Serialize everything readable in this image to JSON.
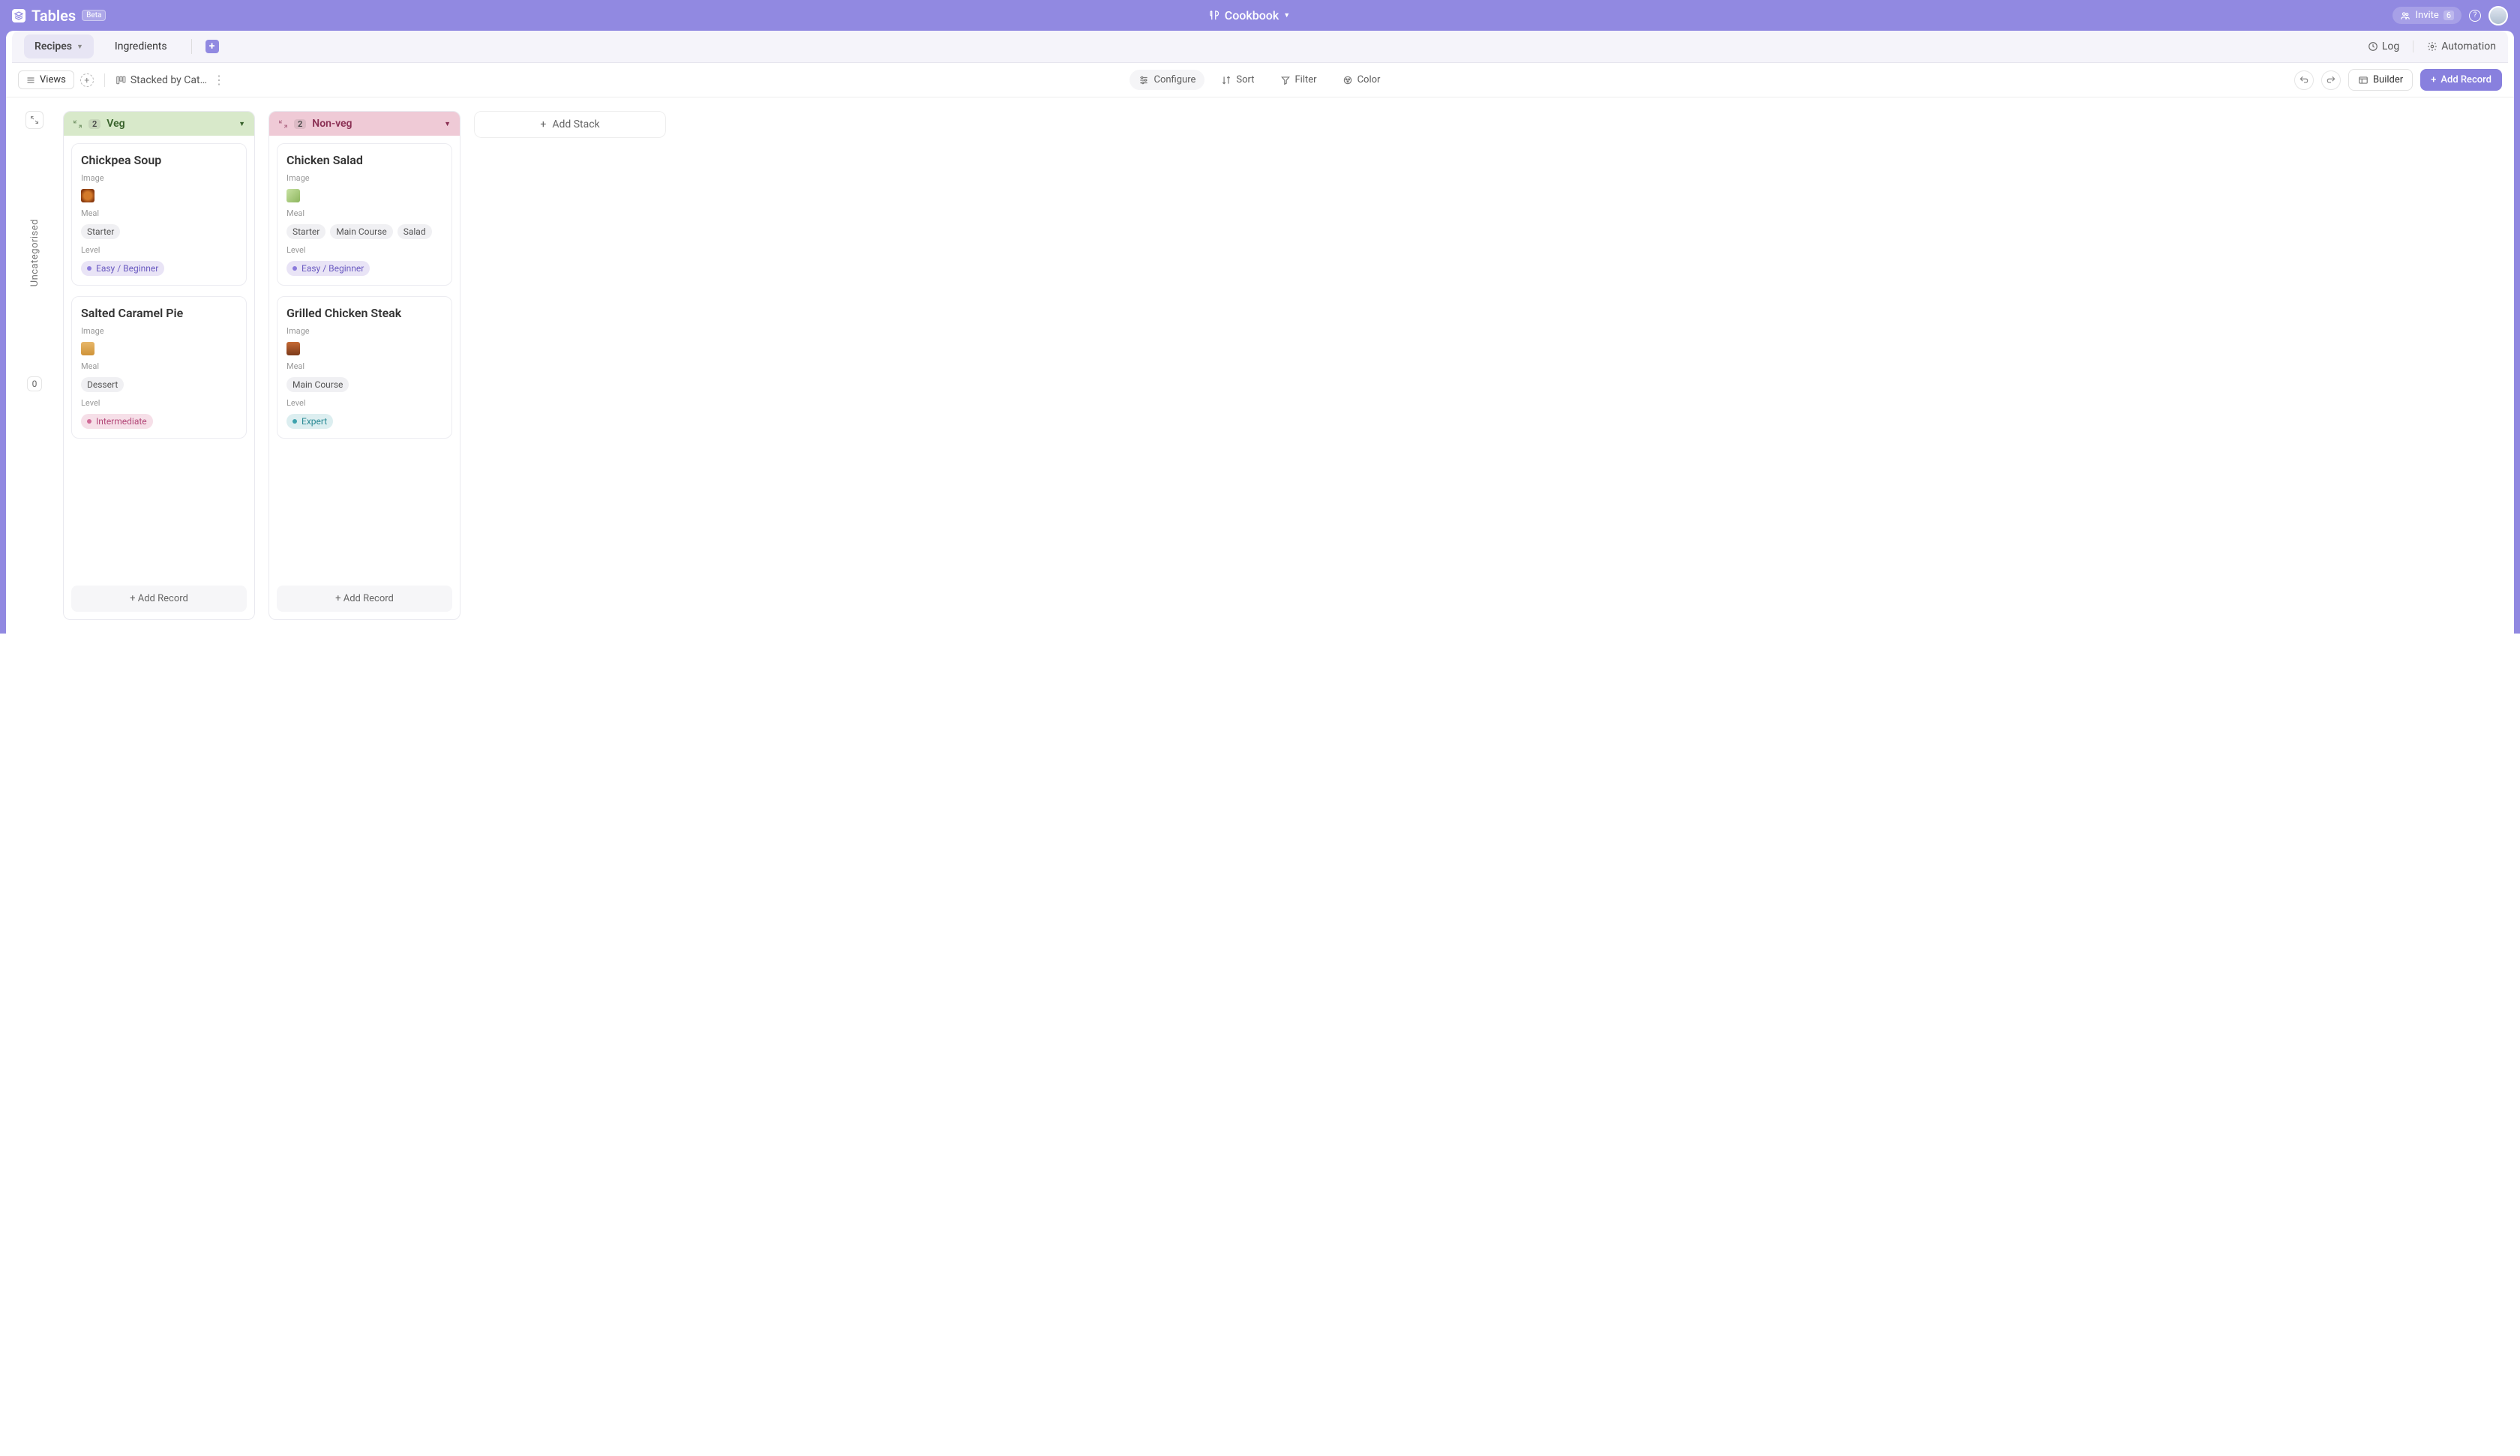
{
  "header": {
    "app_title": "Tables",
    "beta": "Beta",
    "workspace": "Cookbook",
    "invite_label": "Invite",
    "notify_count": "6"
  },
  "tabs": {
    "items": [
      {
        "label": "Recipes",
        "active": true
      },
      {
        "label": "Ingredients",
        "active": false
      }
    ],
    "log": "Log",
    "automation": "Automation"
  },
  "toolbar": {
    "views": "Views",
    "current_view": "Stacked by Cat…",
    "configure": "Configure",
    "sort": "Sort",
    "filter": "Filter",
    "color": "Color",
    "builder": "Builder",
    "add_record": "Add Record"
  },
  "side": {
    "label": "Uncategorised",
    "count": "0"
  },
  "stacks": [
    {
      "id": "veg",
      "title": "Veg",
      "count": "2",
      "cards": [
        {
          "title": "Chickpea Soup",
          "image_label": "Image",
          "thumb": "soup",
          "meal_label": "Meal",
          "meal": [
            "Starter"
          ],
          "level_label": "Level",
          "level": "Easy / Beginner",
          "level_class": "easy"
        },
        {
          "title": "Salted Caramel Pie",
          "image_label": "Image",
          "thumb": "pie",
          "meal_label": "Meal",
          "meal": [
            "Dessert"
          ],
          "level_label": "Level",
          "level": "Intermediate",
          "level_class": "int"
        }
      ]
    },
    {
      "id": "nonveg",
      "title": "Non-veg",
      "count": "2",
      "cards": [
        {
          "title": "Chicken Salad",
          "image_label": "Image",
          "thumb": "salad",
          "meal_label": "Meal",
          "meal": [
            "Starter",
            "Main Course",
            "Salad"
          ],
          "level_label": "Level",
          "level": "Easy / Beginner",
          "level_class": "easy"
        },
        {
          "title": "Grilled Chicken Steak",
          "image_label": "Image",
          "thumb": "steak",
          "meal_label": "Meal",
          "meal": [
            "Main Course"
          ],
          "level_label": "Level",
          "level": "Expert",
          "level_class": "exp"
        }
      ]
    }
  ],
  "add_stack": "Add Stack",
  "add_record_row": "+ Add Record"
}
